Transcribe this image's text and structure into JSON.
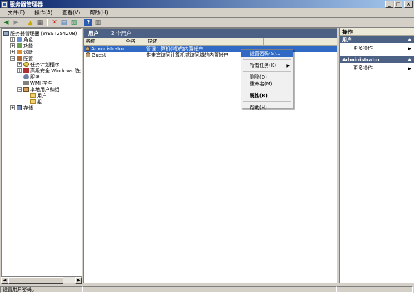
{
  "window": {
    "title": "服务器管理器",
    "min": "_",
    "max": "□",
    "close": "×"
  },
  "menu": [
    "文件(F)",
    "操作(A)",
    "查看(V)",
    "帮助(H)"
  ],
  "toolbar": {
    "back": "◀",
    "forward": "▶",
    "up": "▲",
    "grid": "▦",
    "delete": "✕",
    "properties": "▤",
    "export": "▧",
    "help": "?",
    "view": "▥"
  },
  "tree": [
    {
      "label": "服务器管理器 (WEST254208)",
      "indent": 0,
      "exp": "",
      "icon": "ic-server",
      "icon_name": "server-icon"
    },
    {
      "label": "角色",
      "indent": 1,
      "exp": "+",
      "icon": "ic-roles",
      "icon_name": "roles-icon"
    },
    {
      "label": "功能",
      "indent": 1,
      "exp": "+",
      "icon": "ic-features",
      "icon_name": "features-icon"
    },
    {
      "label": "诊断",
      "indent": 1,
      "exp": "+",
      "icon": "ic-diag",
      "icon_name": "diagnostics-icon"
    },
    {
      "label": "配置",
      "indent": 1,
      "exp": "−",
      "icon": "ic-config",
      "icon_name": "config-icon"
    },
    {
      "label": "任务计划程序",
      "indent": 2,
      "exp": "+",
      "icon": "ic-task",
      "icon_name": "task-scheduler-icon"
    },
    {
      "label": "高级安全 Windows 防火墙",
      "indent": 2,
      "exp": "+",
      "icon": "ic-firewall",
      "icon_name": "firewall-icon"
    },
    {
      "label": "服务",
      "indent": 2,
      "exp": "",
      "icon": "ic-services",
      "icon_name": "services-icon"
    },
    {
      "label": "WMI 控件",
      "indent": 2,
      "exp": "",
      "icon": "ic-wmi",
      "icon_name": "wmi-icon"
    },
    {
      "label": "本地用户和组",
      "indent": 2,
      "exp": "−",
      "icon": "ic-users",
      "icon_name": "local-users-icon"
    },
    {
      "label": "用户",
      "indent": 3,
      "exp": "",
      "icon": "ic-folder",
      "icon_name": "folder-icon"
    },
    {
      "label": "组",
      "indent": 3,
      "exp": "",
      "icon": "ic-folder",
      "icon_name": "folder-icon"
    },
    {
      "label": "存储",
      "indent": 1,
      "exp": "+",
      "icon": "ic-storage",
      "icon_name": "storage-icon"
    }
  ],
  "content": {
    "header_title": "用户",
    "header_count": "2 个用户",
    "columns": [
      "名称",
      "全名",
      "描述"
    ],
    "rows": [
      {
        "name": "Administrator",
        "fullname": "",
        "desc": "管理计算机(域)的内置帐户",
        "selected": true
      },
      {
        "name": "Guest",
        "fullname": "",
        "desc": "供来宾访问计算机或访问域的内置帐户",
        "selected": false
      }
    ]
  },
  "context_menu": {
    "set_password": "设置密码(S)...",
    "all_tasks": "所有任务(K)",
    "delete": "删除(D)",
    "rename": "重命名(M)",
    "properties": "属性(R)",
    "help": "帮助(H)"
  },
  "actions": {
    "header": "操作",
    "section1": "用户",
    "more1": "更多操作",
    "section2": "Administrator",
    "more2": "更多操作"
  },
  "status": {
    "text": "设置用户密码。"
  },
  "scroll": {
    "left": "◀",
    "right": "▶"
  }
}
